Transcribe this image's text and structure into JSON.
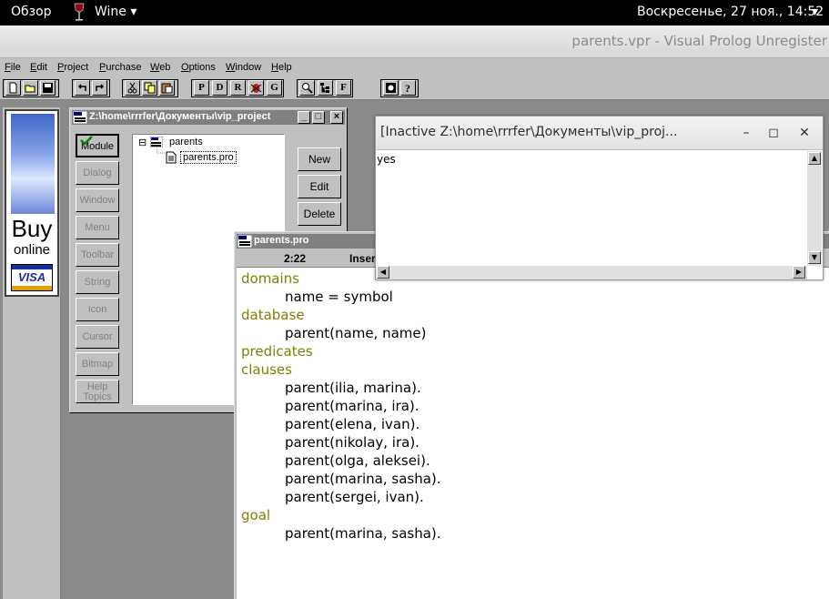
{
  "topbar": {
    "activities": "Обзор",
    "app_name": "Wine",
    "app_menu_arrow": "▾",
    "clock": "Воскресенье, 27 ноя., 14:52",
    "system_menu_arrow": "▾"
  },
  "window": {
    "title": "parents.vpr - Visual Prolog Unregister"
  },
  "menubar": {
    "items": [
      "File",
      "Edit",
      "Project",
      "Purchase",
      "Web",
      "Options",
      "Window",
      "Help"
    ]
  },
  "toolbar": {
    "letter_buttons": [
      "P",
      "D",
      "R",
      "G",
      "F"
    ]
  },
  "ad": {
    "buy": "Buy",
    "online": "online",
    "card": "VISA"
  },
  "project_window": {
    "title": "Z:\\home\\rrrfer\\Документы\\vip_project",
    "side_buttons": [
      "Module",
      "Dialog",
      "Window",
      "Menu",
      "Toolbar",
      "String",
      "Icon",
      "Cursor",
      "Bitmap",
      "Help Topics"
    ],
    "command_buttons": [
      "New",
      "Edit",
      "Delete"
    ],
    "tree": {
      "root": "parents",
      "child": "parents.pro",
      "expander": "⊟"
    }
  },
  "editor": {
    "title": "parents.pro",
    "position": "2:22",
    "mode": "Insert",
    "lines": [
      {
        "text": "domains",
        "kw": true
      },
      {
        "text": "name = symbol",
        "kw": false
      },
      {
        "text": "database",
        "kw": true
      },
      {
        "text": "parent(name, name)",
        "kw": false
      },
      {
        "text": "predicates",
        "kw": true
      },
      {
        "text": "clauses",
        "kw": true
      },
      {
        "text": "parent(ilia, marina).",
        "kw": false
      },
      {
        "text": "parent(marina, ira).",
        "kw": false
      },
      {
        "text": "parent(elena, ivan).",
        "kw": false
      },
      {
        "text": "parent(nikolay, ira).",
        "kw": false
      },
      {
        "text": "parent(olga, aleksei).",
        "kw": false
      },
      {
        "text": "parent(marina, sasha).",
        "kw": false
      },
      {
        "text": "parent(sergei, ivan).",
        "kw": false
      },
      {
        "text": "goal",
        "kw": true
      },
      {
        "text": "parent(marina, sasha).",
        "kw": false
      }
    ]
  },
  "output_window": {
    "title": "[Inactive Z:\\home\\rrrfer\\Документы\\vip_proj...",
    "output": "yes",
    "minimize": "–",
    "maximize": "◻",
    "close": "✕"
  }
}
